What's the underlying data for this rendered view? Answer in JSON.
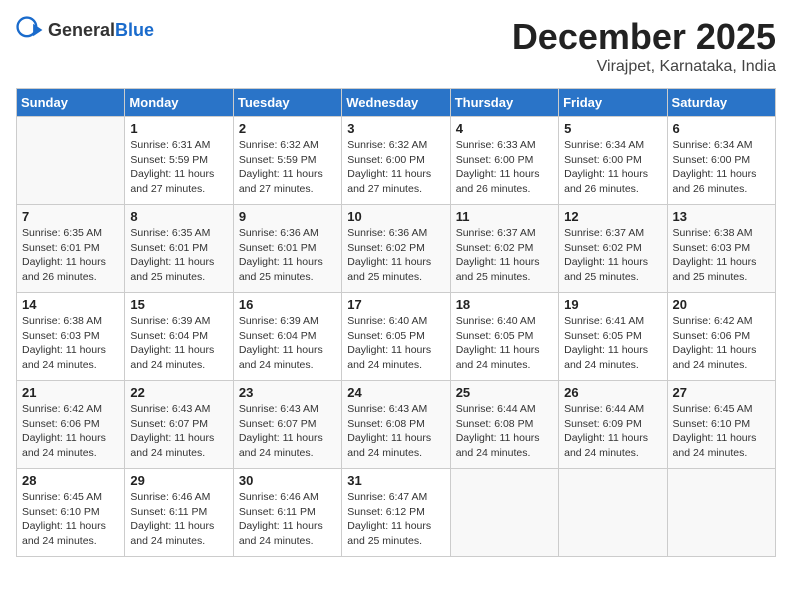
{
  "header": {
    "logo_general": "General",
    "logo_blue": "Blue",
    "month_year": "December 2025",
    "location": "Virajpet, Karnataka, India"
  },
  "days_of_week": [
    "Sunday",
    "Monday",
    "Tuesday",
    "Wednesday",
    "Thursday",
    "Friday",
    "Saturday"
  ],
  "weeks": [
    [
      {
        "day": "",
        "sunrise": "",
        "sunset": "",
        "daylight": "",
        "empty": true
      },
      {
        "day": "1",
        "sunrise": "6:31 AM",
        "sunset": "5:59 PM",
        "daylight": "11 hours and 27 minutes.",
        "empty": false
      },
      {
        "day": "2",
        "sunrise": "6:32 AM",
        "sunset": "5:59 PM",
        "daylight": "11 hours and 27 minutes.",
        "empty": false
      },
      {
        "day": "3",
        "sunrise": "6:32 AM",
        "sunset": "6:00 PM",
        "daylight": "11 hours and 27 minutes.",
        "empty": false
      },
      {
        "day": "4",
        "sunrise": "6:33 AM",
        "sunset": "6:00 PM",
        "daylight": "11 hours and 26 minutes.",
        "empty": false
      },
      {
        "day": "5",
        "sunrise": "6:34 AM",
        "sunset": "6:00 PM",
        "daylight": "11 hours and 26 minutes.",
        "empty": false
      },
      {
        "day": "6",
        "sunrise": "6:34 AM",
        "sunset": "6:00 PM",
        "daylight": "11 hours and 26 minutes.",
        "empty": false
      }
    ],
    [
      {
        "day": "7",
        "sunrise": "6:35 AM",
        "sunset": "6:01 PM",
        "daylight": "11 hours and 26 minutes.",
        "empty": false
      },
      {
        "day": "8",
        "sunrise": "6:35 AM",
        "sunset": "6:01 PM",
        "daylight": "11 hours and 25 minutes.",
        "empty": false
      },
      {
        "day": "9",
        "sunrise": "6:36 AM",
        "sunset": "6:01 PM",
        "daylight": "11 hours and 25 minutes.",
        "empty": false
      },
      {
        "day": "10",
        "sunrise": "6:36 AM",
        "sunset": "6:02 PM",
        "daylight": "11 hours and 25 minutes.",
        "empty": false
      },
      {
        "day": "11",
        "sunrise": "6:37 AM",
        "sunset": "6:02 PM",
        "daylight": "11 hours and 25 minutes.",
        "empty": false
      },
      {
        "day": "12",
        "sunrise": "6:37 AM",
        "sunset": "6:02 PM",
        "daylight": "11 hours and 25 minutes.",
        "empty": false
      },
      {
        "day": "13",
        "sunrise": "6:38 AM",
        "sunset": "6:03 PM",
        "daylight": "11 hours and 25 minutes.",
        "empty": false
      }
    ],
    [
      {
        "day": "14",
        "sunrise": "6:38 AM",
        "sunset": "6:03 PM",
        "daylight": "11 hours and 24 minutes.",
        "empty": false
      },
      {
        "day": "15",
        "sunrise": "6:39 AM",
        "sunset": "6:04 PM",
        "daylight": "11 hours and 24 minutes.",
        "empty": false
      },
      {
        "day": "16",
        "sunrise": "6:39 AM",
        "sunset": "6:04 PM",
        "daylight": "11 hours and 24 minutes.",
        "empty": false
      },
      {
        "day": "17",
        "sunrise": "6:40 AM",
        "sunset": "6:05 PM",
        "daylight": "11 hours and 24 minutes.",
        "empty": false
      },
      {
        "day": "18",
        "sunrise": "6:40 AM",
        "sunset": "6:05 PM",
        "daylight": "11 hours and 24 minutes.",
        "empty": false
      },
      {
        "day": "19",
        "sunrise": "6:41 AM",
        "sunset": "6:05 PM",
        "daylight": "11 hours and 24 minutes.",
        "empty": false
      },
      {
        "day": "20",
        "sunrise": "6:42 AM",
        "sunset": "6:06 PM",
        "daylight": "11 hours and 24 minutes.",
        "empty": false
      }
    ],
    [
      {
        "day": "21",
        "sunrise": "6:42 AM",
        "sunset": "6:06 PM",
        "daylight": "11 hours and 24 minutes.",
        "empty": false
      },
      {
        "day": "22",
        "sunrise": "6:43 AM",
        "sunset": "6:07 PM",
        "daylight": "11 hours and 24 minutes.",
        "empty": false
      },
      {
        "day": "23",
        "sunrise": "6:43 AM",
        "sunset": "6:07 PM",
        "daylight": "11 hours and 24 minutes.",
        "empty": false
      },
      {
        "day": "24",
        "sunrise": "6:43 AM",
        "sunset": "6:08 PM",
        "daylight": "11 hours and 24 minutes.",
        "empty": false
      },
      {
        "day": "25",
        "sunrise": "6:44 AM",
        "sunset": "6:08 PM",
        "daylight": "11 hours and 24 minutes.",
        "empty": false
      },
      {
        "day": "26",
        "sunrise": "6:44 AM",
        "sunset": "6:09 PM",
        "daylight": "11 hours and 24 minutes.",
        "empty": false
      },
      {
        "day": "27",
        "sunrise": "6:45 AM",
        "sunset": "6:10 PM",
        "daylight": "11 hours and 24 minutes.",
        "empty": false
      }
    ],
    [
      {
        "day": "28",
        "sunrise": "6:45 AM",
        "sunset": "6:10 PM",
        "daylight": "11 hours and 24 minutes.",
        "empty": false
      },
      {
        "day": "29",
        "sunrise": "6:46 AM",
        "sunset": "6:11 PM",
        "daylight": "11 hours and 24 minutes.",
        "empty": false
      },
      {
        "day": "30",
        "sunrise": "6:46 AM",
        "sunset": "6:11 PM",
        "daylight": "11 hours and 24 minutes.",
        "empty": false
      },
      {
        "day": "31",
        "sunrise": "6:47 AM",
        "sunset": "6:12 PM",
        "daylight": "11 hours and 25 minutes.",
        "empty": false
      },
      {
        "day": "",
        "sunrise": "",
        "sunset": "",
        "daylight": "",
        "empty": true
      },
      {
        "day": "",
        "sunrise": "",
        "sunset": "",
        "daylight": "",
        "empty": true
      },
      {
        "day": "",
        "sunrise": "",
        "sunset": "",
        "daylight": "",
        "empty": true
      }
    ]
  ]
}
